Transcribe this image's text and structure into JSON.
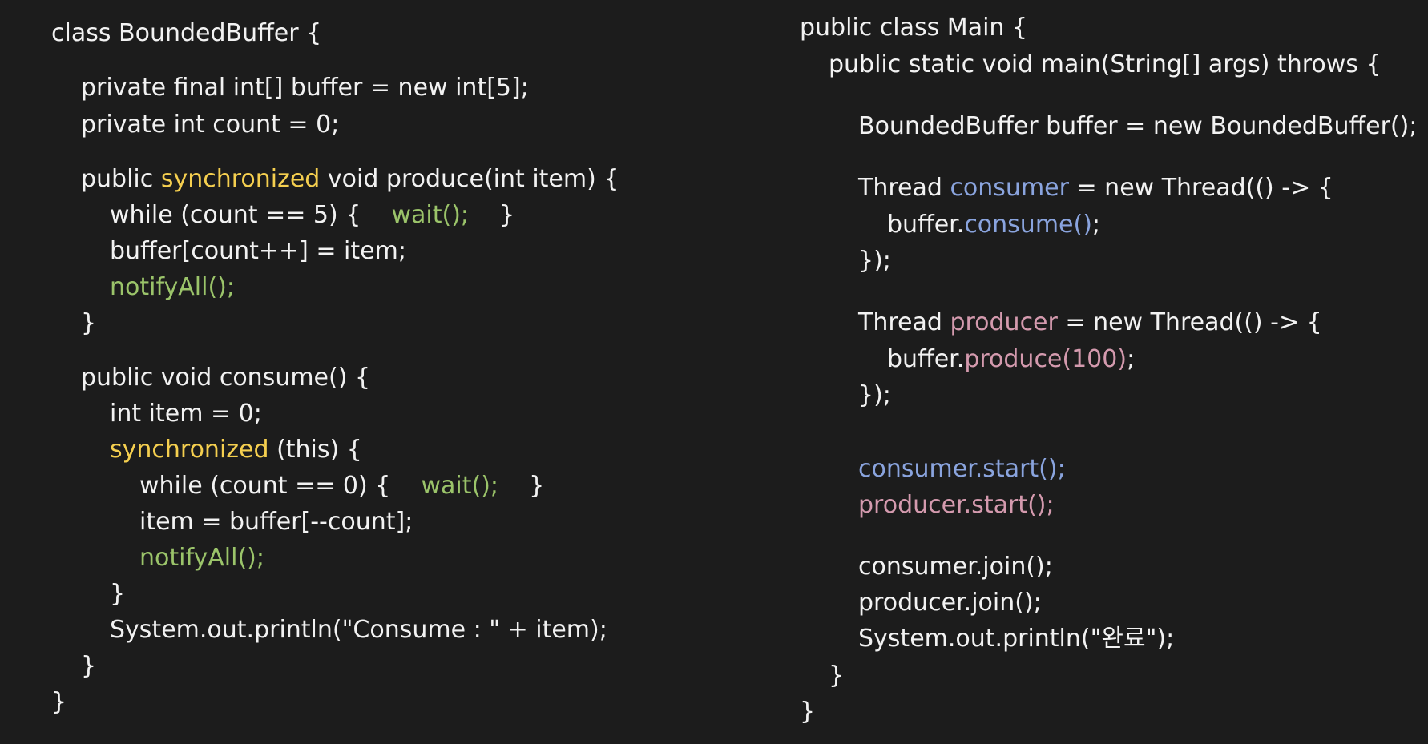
{
  "colors": {
    "background": "#1c1c1c",
    "text": "#f2f2f2",
    "keyword_synchronized": "#f5cf4f",
    "wait_notify": "#9bc46a",
    "consumer": "#8aa4de",
    "producer": "#d49aae"
  },
  "left_panel": {
    "lines": [
      [
        {
          "t": "class BoundedBuffer {",
          "c": "plain"
        }
      ],
      [
        {
          "t": "private final int[] buffer = new int[5];",
          "c": "plain"
        }
      ],
      [
        {
          "t": "private int count = 0;",
          "c": "plain"
        }
      ],
      [
        {
          "t": "public ",
          "c": "plain"
        },
        {
          "t": "synchronized",
          "c": "yellow"
        },
        {
          "t": " void produce(int item) {",
          "c": "plain"
        }
      ],
      [
        {
          "t": "while (count == 5) {    ",
          "c": "plain"
        },
        {
          "t": "wait();",
          "c": "green"
        },
        {
          "t": "    }",
          "c": "plain"
        }
      ],
      [
        {
          "t": "buffer[count++] = item;",
          "c": "plain"
        }
      ],
      [
        {
          "t": "notifyAll();",
          "c": "green"
        }
      ],
      [
        {
          "t": "}",
          "c": "plain"
        }
      ],
      [
        {
          "t": "public void consume() {",
          "c": "plain"
        }
      ],
      [
        {
          "t": "int item = 0;",
          "c": "plain"
        }
      ],
      [
        {
          "t": "synchronized",
          "c": "yellow"
        },
        {
          "t": " (this) {",
          "c": "plain"
        }
      ],
      [
        {
          "t": "while (count == 0) {    ",
          "c": "plain"
        },
        {
          "t": "wait();",
          "c": "green"
        },
        {
          "t": "    }",
          "c": "plain"
        }
      ],
      [
        {
          "t": "item = buffer[--count];",
          "c": "plain"
        }
      ],
      [
        {
          "t": "notifyAll();",
          "c": "green"
        }
      ],
      [
        {
          "t": "}",
          "c": "plain"
        }
      ],
      [
        {
          "t": "System.out.println(\"Consume : \" + item);",
          "c": "plain"
        }
      ],
      [
        {
          "t": "}",
          "c": "plain"
        }
      ],
      [
        {
          "t": "}",
          "c": "plain"
        }
      ]
    ]
  },
  "right_panel": {
    "lines": [
      [
        {
          "t": "public class Main {",
          "c": "plain"
        }
      ],
      [
        {
          "t": "public static void main(String[] args) throws {",
          "c": "plain"
        }
      ],
      [
        {
          "t": "BoundedBuffer buffer = new BoundedBuffer();",
          "c": "plain"
        }
      ],
      [
        {
          "t": "Thread ",
          "c": "plain"
        },
        {
          "t": "consumer",
          "c": "blue"
        },
        {
          "t": " = new Thread(() -> {",
          "c": "plain"
        }
      ],
      [
        {
          "t": "buffer.",
          "c": "plain"
        },
        {
          "t": "consume()",
          "c": "blue"
        },
        {
          "t": ";",
          "c": "plain"
        }
      ],
      [
        {
          "t": "});",
          "c": "plain"
        }
      ],
      [
        {
          "t": "Thread ",
          "c": "plain"
        },
        {
          "t": "producer",
          "c": "pink"
        },
        {
          "t": " = new Thread(() -> {",
          "c": "plain"
        }
      ],
      [
        {
          "t": "buffer.",
          "c": "plain"
        },
        {
          "t": "produce(100)",
          "c": "pink"
        },
        {
          "t": ";",
          "c": "plain"
        }
      ],
      [
        {
          "t": "});",
          "c": "plain"
        }
      ],
      [
        {
          "t": "consumer.start();",
          "c": "blue"
        }
      ],
      [
        {
          "t": "producer.start();",
          "c": "pink"
        }
      ],
      [
        {
          "t": "consumer.join();",
          "c": "plain"
        }
      ],
      [
        {
          "t": "producer.join();",
          "c": "plain"
        }
      ],
      [
        {
          "t": "System.out.println(\"완료\");",
          "c": "plain"
        }
      ],
      [
        {
          "t": "}",
          "c": "plain"
        }
      ],
      [
        {
          "t": "}",
          "c": "plain"
        }
      ]
    ]
  }
}
